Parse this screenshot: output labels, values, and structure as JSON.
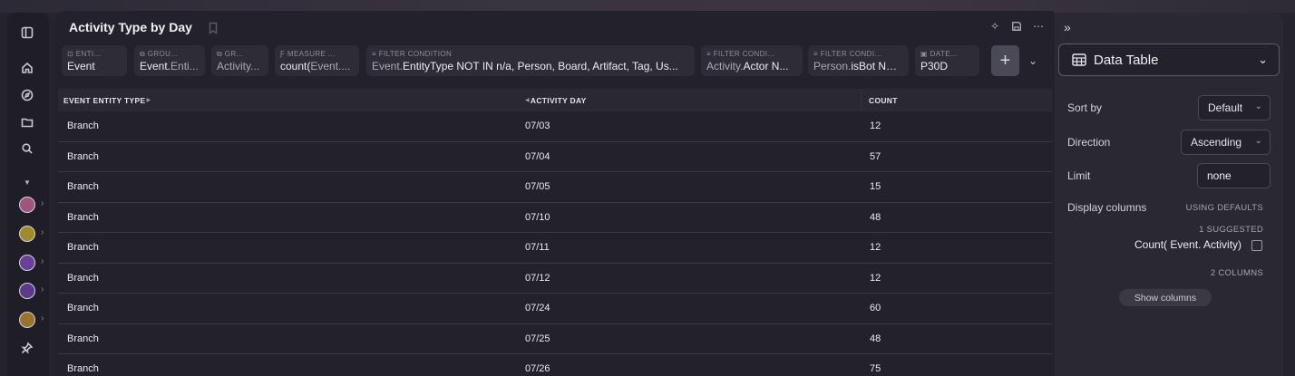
{
  "report": {
    "title": "Activity Type by Day"
  },
  "chips": [
    {
      "label": "ENTI...",
      "value": "Event",
      "value_dim": "",
      "icon": "entity-icon"
    },
    {
      "label": "GROU...",
      "value": "Event.",
      "value_dim": "Enti...",
      "icon": "group-icon"
    },
    {
      "label": "GR...",
      "value": "",
      "value_dim": "Activity...",
      "icon": "group-icon"
    },
    {
      "label": "MEASURE ...",
      "value": "count(",
      "value_dim": "Event....",
      "icon": "measure-icon"
    },
    {
      "label": "FILTER CONDITION",
      "value": "",
      "value_dim": "Event.",
      "value2": "EntityType NOT IN n/a, Person, Board, Artifact, Tag, Us...",
      "icon": "filter-icon"
    },
    {
      "label": "FILTER CONDI...",
      "value": "",
      "value_dim": "Activity.",
      "value2": "Actor N...",
      "icon": "filter-icon"
    },
    {
      "label": "FILTER CONDI...",
      "value": "",
      "value_dim": "Person.",
      "value2": "isBot NO...",
      "icon": "filter-icon"
    },
    {
      "label": "DATE...",
      "value": "P30D",
      "value_dim": "",
      "icon": "calendar-icon"
    }
  ],
  "add_label": "+",
  "table": {
    "columns": [
      "EVENT ENTITY TYPE",
      "ACTIVITY DAY",
      "COUNT"
    ],
    "rows": [
      [
        "Branch",
        "07/03",
        "12"
      ],
      [
        "Branch",
        "07/04",
        "57"
      ],
      [
        "Branch",
        "07/05",
        "15"
      ],
      [
        "Branch",
        "07/10",
        "48"
      ],
      [
        "Branch",
        "07/11",
        "12"
      ],
      [
        "Branch",
        "07/12",
        "12"
      ],
      [
        "Branch",
        "07/24",
        "60"
      ],
      [
        "Branch",
        "07/25",
        "48"
      ],
      [
        "Branch",
        "07/26",
        "75"
      ]
    ]
  },
  "panel": {
    "viz_type": "Data Table",
    "sort_by_label": "Sort by",
    "sort_by_value": "Default",
    "direction_label": "Direction",
    "direction_value": "Ascending",
    "limit_label": "Limit",
    "limit_value": "none",
    "display_columns_label": "Display columns",
    "using_defaults": "USING DEFAULTS",
    "suggested_count": "1 SUGGESTED",
    "suggested_column": "Count( Event. Activity)",
    "columns_count": "2 COLUMNS",
    "show_columns": "Show columns"
  },
  "colors": {
    "dot_1": "#a1547c",
    "dot_2": "#a08a2c",
    "dot_3": "#6a3f9a",
    "dot_4": "#5b3a8c",
    "dot_5": "#9a742c"
  }
}
